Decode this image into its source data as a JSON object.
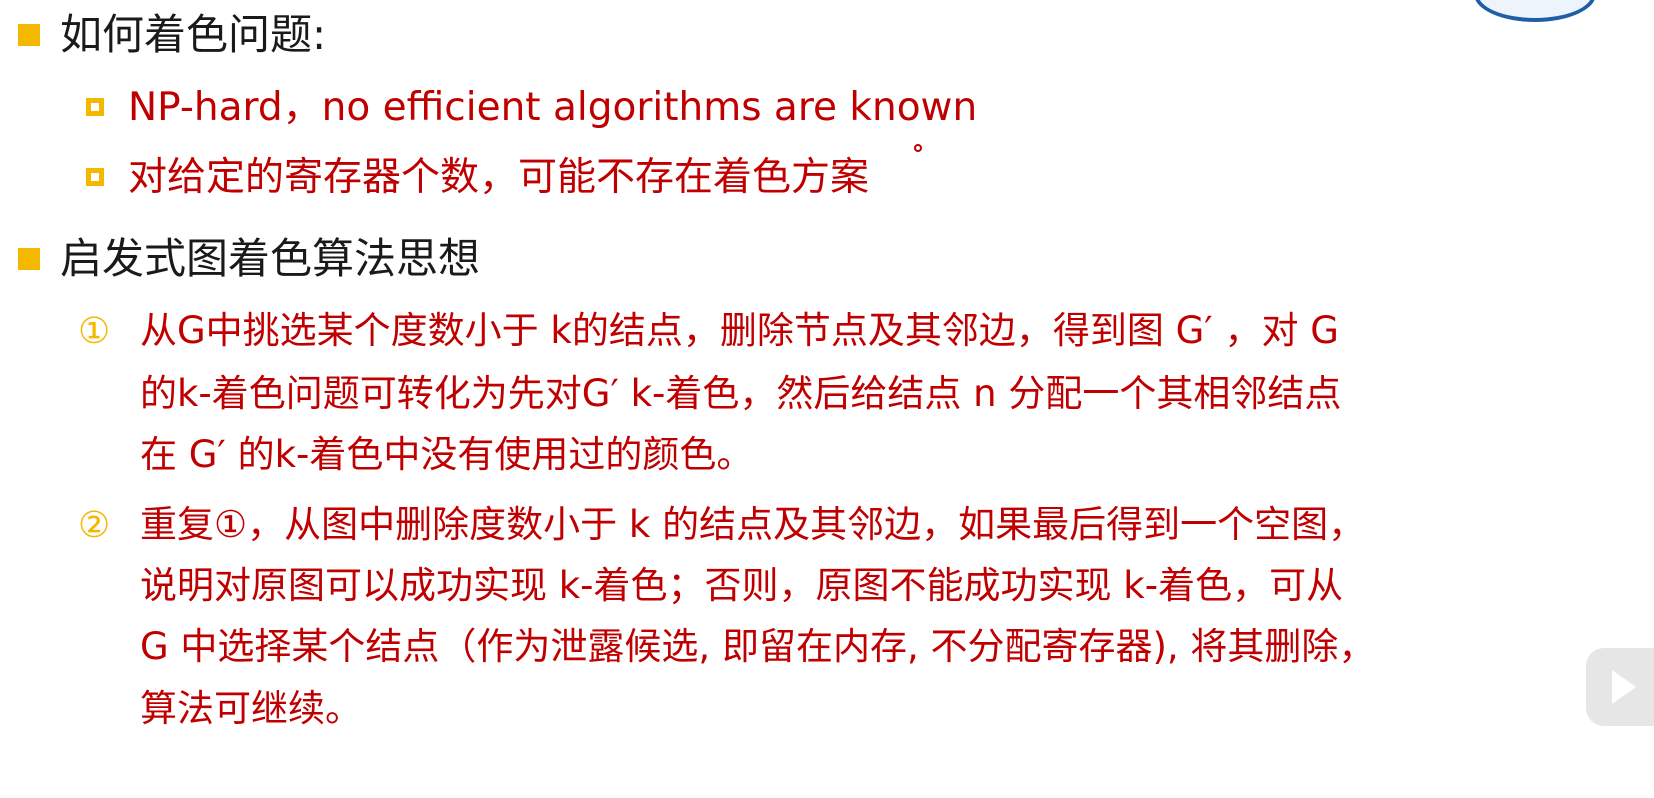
{
  "colors": {
    "bullet_primary": "#f5b800",
    "text_primary": "#1a1a1a",
    "text_accent": "#c00000",
    "number_marker": "#f5b800"
  },
  "section1": {
    "heading": "如何着色问题:",
    "items": [
      "NP-hard，no efficient algorithms are known",
      "对给定的寄存器个数，可能不存在着色方案"
    ]
  },
  "section2": {
    "heading": "启发式图着色算法思想",
    "steps": [
      {
        "marker": "①",
        "lines": [
          "从G中挑选某个度数小于  k的结点，删除节点及其邻边，得到图  G′  ，对  G",
          "的k-着色问题可转化为先对G′   k-着色，然后给结点 n 分配一个其相邻结点",
          "在 G′   的k-着色中没有使用过的颜色。"
        ]
      },
      {
        "marker": "②",
        "lines": [
          " 重复①，从图中删除度数小于  k  的结点及其邻边，如果最后得到一个空图，",
          "说明对原图可以成功实现  k-着色；否则，原图不能成功实现  k-着色，可从",
          "G 中选择某个结点（作为泄露候选, 即留在内存, 不分配寄存器), 将其删除，",
          "算法可继续。"
        ]
      }
    ]
  },
  "logo": {
    "icon": "university-seal-icon"
  },
  "player": {
    "icon": "play-icon"
  }
}
